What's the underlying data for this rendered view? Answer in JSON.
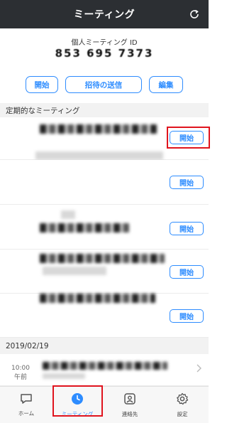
{
  "header": {
    "title": "ミーティング",
    "refresh_icon": "refresh-icon"
  },
  "pmi": {
    "label": "個人ミーティング ID",
    "id": "853 695 7373"
  },
  "actions": {
    "start": "開始",
    "invite": "招待の送信",
    "edit": "編集"
  },
  "recurring": {
    "header": "定期的なミーティング",
    "start_label": "開始"
  },
  "history": {
    "date": "2019/02/19",
    "time": "10:00",
    "ampm": "午前"
  },
  "tabs": [
    {
      "label": "ホーム",
      "icon": "chat-bubble-icon"
    },
    {
      "label": "ミーティング",
      "icon": "clock-icon"
    },
    {
      "label": "連絡先",
      "icon": "contact-card-icon"
    },
    {
      "label": "設定",
      "icon": "gear-icon"
    }
  ],
  "colors": {
    "accent": "#2d8cff",
    "highlight": "#e0141e",
    "topbar": "#2c2f33"
  }
}
